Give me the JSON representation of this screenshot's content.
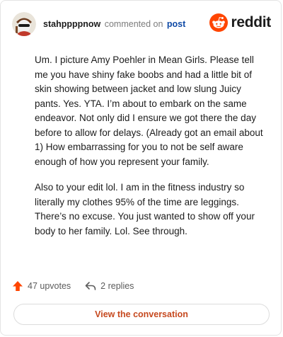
{
  "header": {
    "username": "stahppppnow",
    "action_text": "commented on",
    "post_link": "post",
    "avatar_icon": "avatar-icon",
    "logo_icon": "reddit-alien-icon",
    "logo_text": "reddit",
    "brand_color": "#ff4500"
  },
  "comment": {
    "paragraphs": [
      "Um. I picture Amy Poehler in Mean Girls. Please tell me you have shiny fake boobs and had a little bit of skin showing between jacket and low slung Juicy pants. Yes. YTA. I’m about to embark on the same endeavor. Not only did I ensure we got there the day before to allow for delays. (Already got an email about 1) How embarrassing for you to not be self aware enough of how you represent your family.",
      "Also to your edit lol. I am in the fitness industry so literally my clothes 95% of the time are leggings. There’s no excuse. You just wanted to show off your body to her family. Lol. See through."
    ]
  },
  "stats": {
    "upvotes": "47 upvotes",
    "replies": "2 replies",
    "upvote_icon": "upvote-arrow-icon",
    "reply_icon": "reply-arrow-icon"
  },
  "footer": {
    "button_label": "View the conversation",
    "accent_color": "#c6491f"
  }
}
